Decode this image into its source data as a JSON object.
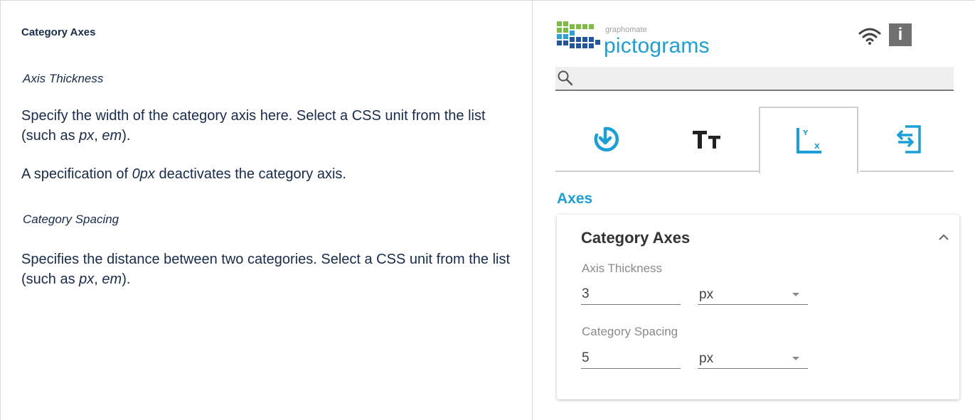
{
  "doc": {
    "heading": "Category Axes",
    "sub1": "Axis Thickness",
    "p1_pre": "Specify the width of the category axis here. Select a CSS unit from the list (such as ",
    "p1_px": "px",
    "p1_mid": ", ",
    "p1_em": "em",
    "p1_post": ").",
    "p2_pre": "A specification of ",
    "p2_val": "0px",
    "p2_post": " deactivates the category axis.",
    "sub2": "Category Spacing",
    "p3_pre": "Specifies the distance between two categories. Select a CSS unit from the list (such as ",
    "p3_px": "px",
    "p3_mid": ", ",
    "p3_em": "em",
    "p3_post": ")."
  },
  "app": {
    "brand_small": "graphomate",
    "brand_big": "pictograms",
    "info_label": "i",
    "search": {
      "value": "",
      "placeholder": ""
    },
    "tabs": [
      {
        "icon": "download-arrow-icon"
      },
      {
        "icon": "text-size-icon"
      },
      {
        "icon": "axes-xy-icon",
        "active": true
      },
      {
        "icon": "import-icon"
      }
    ],
    "section_title": "Axes",
    "card": {
      "title": "Category Axes",
      "axis_thickness_label": "Axis Thickness",
      "axis_thickness_value": "3",
      "axis_thickness_unit": "px",
      "category_spacing_label": "Category Spacing",
      "category_spacing_value": "5",
      "category_spacing_unit": "px"
    }
  },
  "colors": {
    "accent": "#1a9fd9",
    "brand_dark": "#2255a0",
    "brand_green": "#7dbb42"
  }
}
